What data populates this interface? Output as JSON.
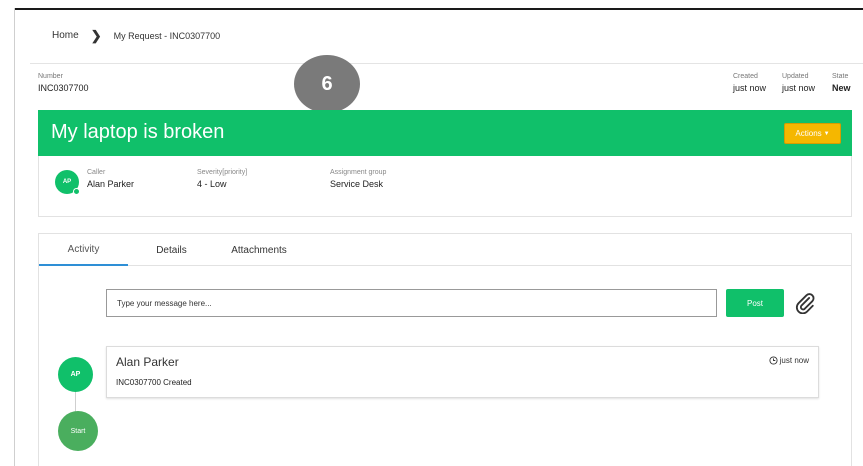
{
  "breadcrumb": {
    "home": "Home",
    "current": "My Request - INC0307700"
  },
  "step_badge": "6",
  "meta": {
    "number_label": "Number",
    "number_value": "INC0307700",
    "created_label": "Created",
    "created_value": "just now",
    "updated_label": "Updated",
    "updated_value": "just now",
    "state_label": "State",
    "state_value": "New"
  },
  "banner": {
    "title": "My laptop is broken",
    "actions_label": "Actions",
    "color": "#10c06a",
    "actions_color": "#f5b700"
  },
  "info": {
    "avatar_initials": "AP",
    "caller_label": "Caller",
    "caller_value": "Alan Parker",
    "severity_label": "Severity[priority]",
    "severity_value": "4 - Low",
    "group_label": "Assignment group",
    "group_value": "Service Desk"
  },
  "tabs": {
    "activity": "Activity",
    "details": "Details",
    "attachments": "Attachments"
  },
  "composer": {
    "placeholder": "Type your message here...",
    "post_label": "Post",
    "attach_icon": "paperclip-icon"
  },
  "timeline": {
    "avatar_initials": "AP",
    "start_label": "Start",
    "entry_name": "Alan Parker",
    "entry_text": "INC0307700 Created",
    "entry_time": "just now",
    "time_icon": "clock-icon"
  }
}
